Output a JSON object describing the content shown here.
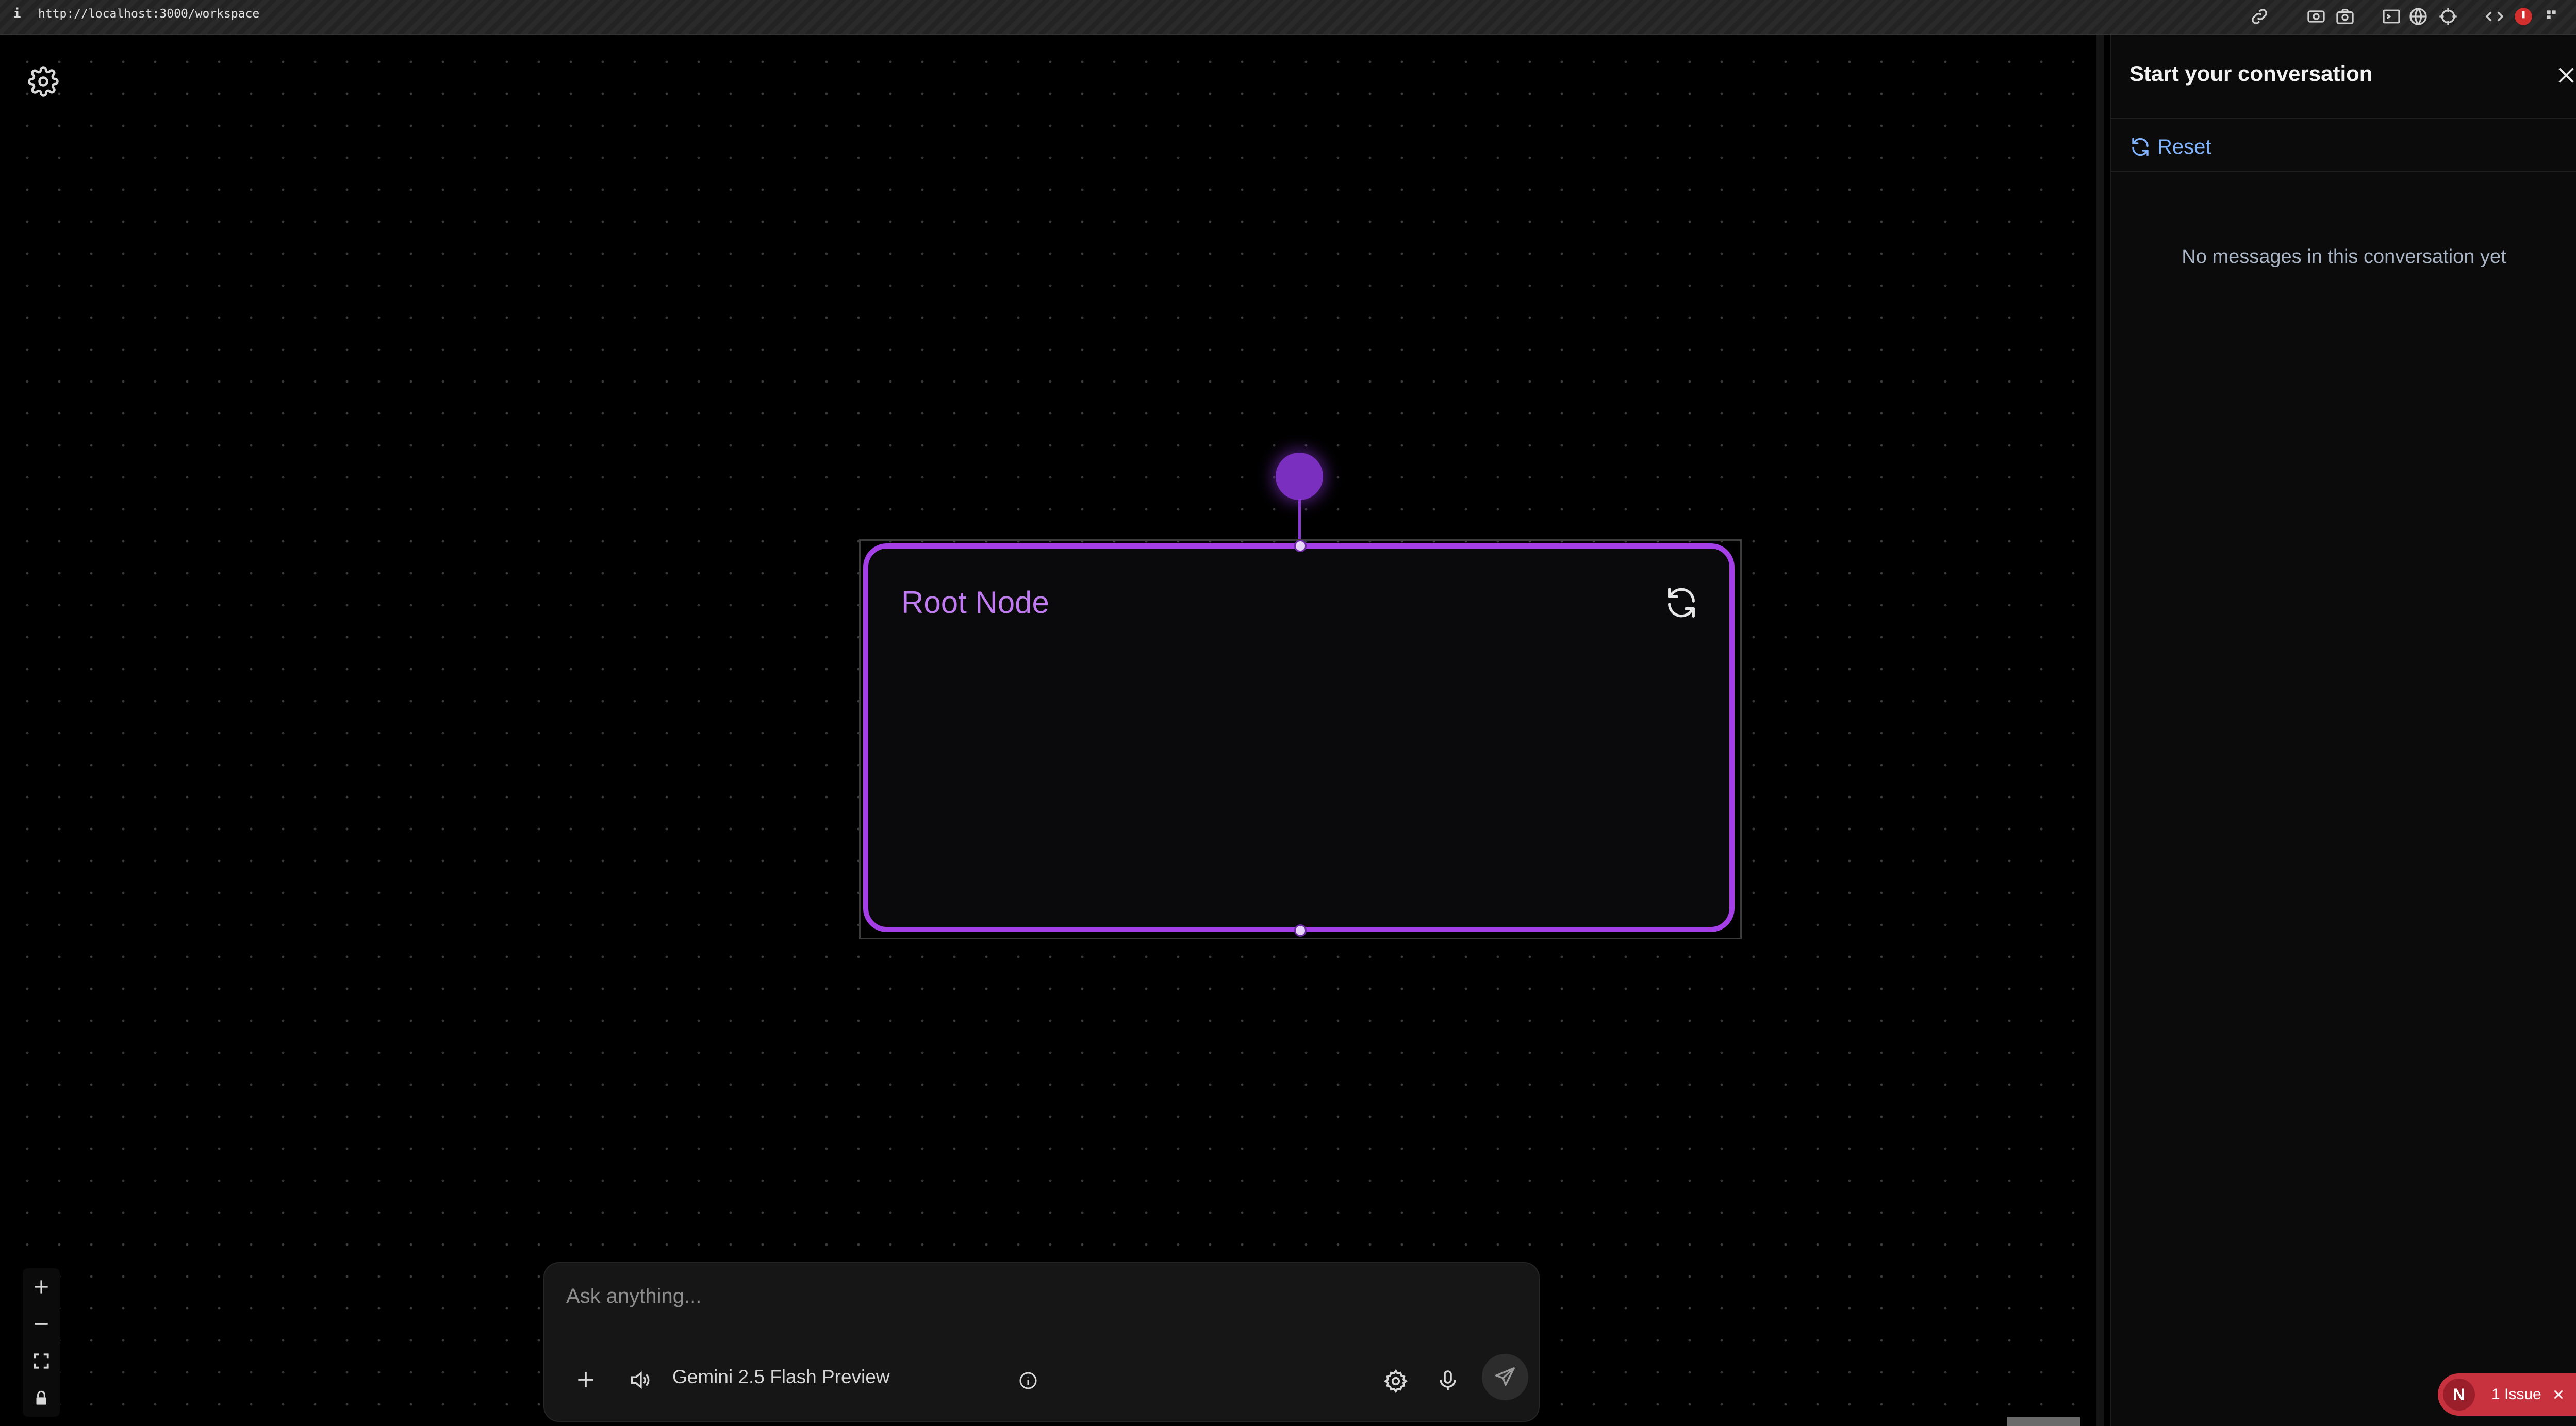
{
  "browser": {
    "info_glyph": "i",
    "url": "http://localhost:3000/workspace",
    "toolbar_icons": [
      "link-icon",
      "video-icon",
      "camera-icon",
      "terminal-icon",
      "globe-icon",
      "crosshair-icon",
      "code-icon",
      "extension-icon",
      "puzzle-icon"
    ]
  },
  "canvas": {
    "settings_icon": "gear-icon",
    "node": {
      "title": "Root Node",
      "refresh_icon": "refresh-icon"
    },
    "zoom_controls": [
      "zoom-in-icon",
      "zoom-out-icon",
      "fit-view-icon",
      "lock-icon"
    ]
  },
  "chat_input": {
    "placeholder": "Ask anything...",
    "value": "",
    "model_name": "Gemini 2.5 Flash Preview",
    "icons": [
      "plus-icon",
      "speaker-icon",
      "info-icon",
      "gear-icon",
      "microphone-icon",
      "send-icon"
    ]
  },
  "conversation_panel": {
    "title": "Start your conversation",
    "reset_label": "Reset",
    "empty_message": "No messages in this conversation yet"
  },
  "issue_badge": {
    "logo_letter": "N",
    "label": "1 Issue"
  },
  "colors": {
    "accent_purple": "#a43fe8",
    "node_title": "#c17bf0",
    "link_blue": "#7fb2ff",
    "issue_red": "#c8323e"
  }
}
